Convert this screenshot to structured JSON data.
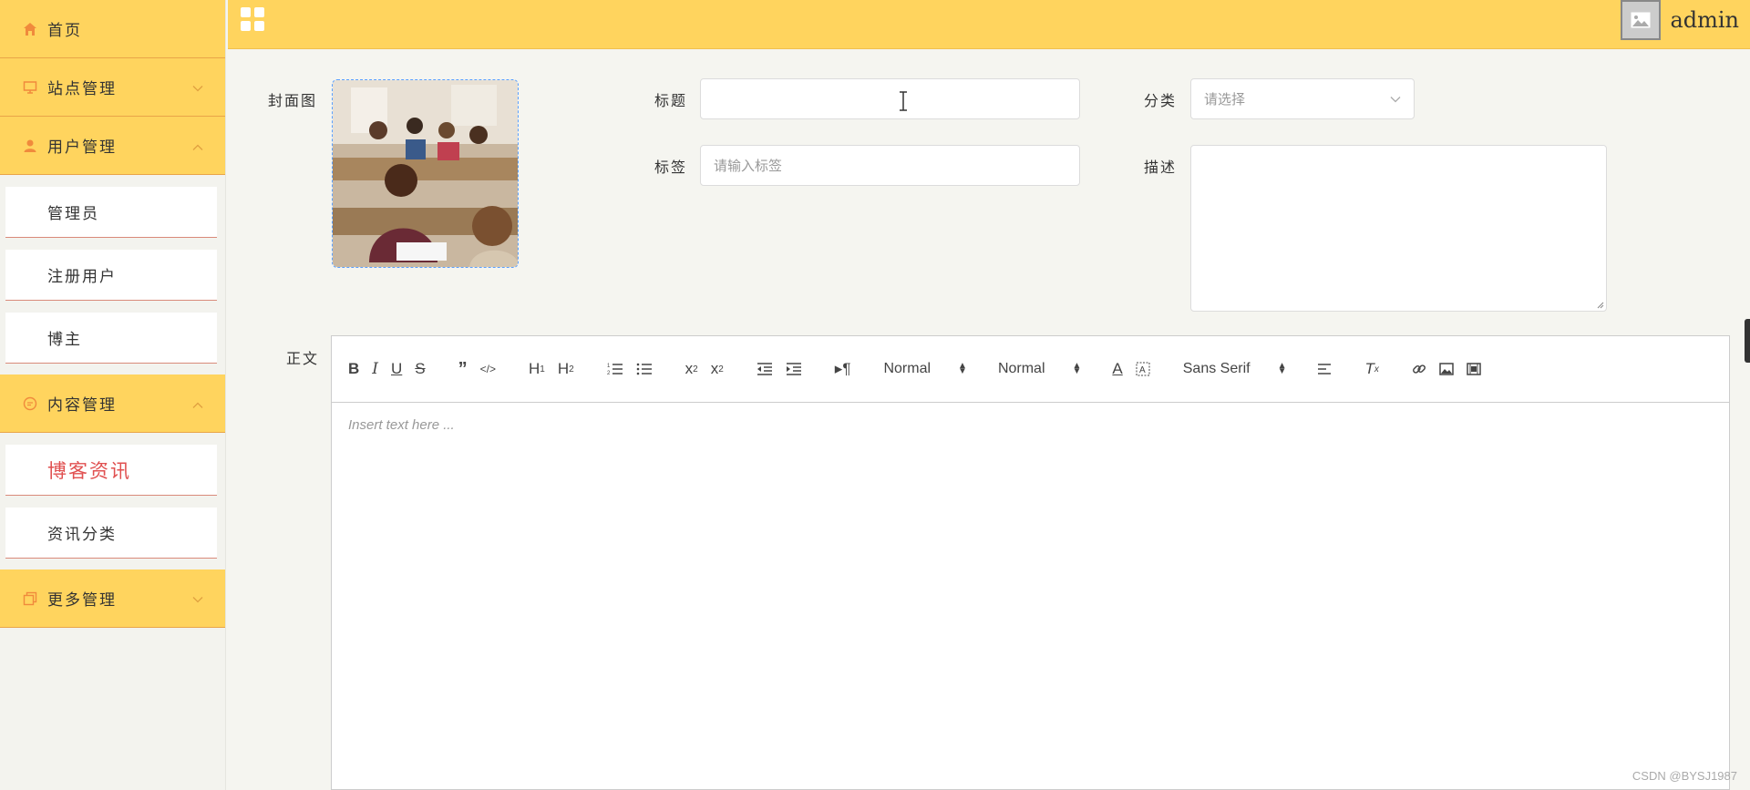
{
  "sidebar": {
    "home": {
      "label": "首页",
      "icon": "home-icon"
    },
    "groups": [
      {
        "label": "站点管理",
        "icon": "monitor-icon",
        "expanded": false
      },
      {
        "label": "用户管理",
        "icon": "user-icon",
        "expanded": true,
        "items": [
          "管理员",
          "注册用户",
          "博主"
        ]
      },
      {
        "label": "内容管理",
        "icon": "chat-icon",
        "expanded": true,
        "items": [
          "博客资讯",
          "资讯分类"
        ]
      },
      {
        "label": "更多管理",
        "icon": "copy-icon",
        "expanded": false
      }
    ],
    "active_item": "博客资讯"
  },
  "topbar": {
    "menu_icon": "grid-icon",
    "username": "admin",
    "avatar_icon": "image-icon"
  },
  "form": {
    "cover_label": "封面图",
    "title_label": "标题",
    "title_value": "",
    "category_label": "分类",
    "category_placeholder": "请选择",
    "tags_label": "标签",
    "tags_placeholder": "请输入标签",
    "desc_label": "描述",
    "desc_value": "",
    "body_label": "正文"
  },
  "editor": {
    "placeholder": "Insert text here ...",
    "header_picker": "Normal",
    "size_picker": "Normal",
    "font_picker": "Sans Serif",
    "buttons": [
      "bold",
      "italic",
      "underline",
      "strike",
      "blockquote",
      "code-block",
      "h1",
      "h2",
      "ordered-list",
      "bullet-list",
      "subscript",
      "superscript",
      "outdent",
      "indent",
      "direction",
      "color",
      "background",
      "align",
      "clean",
      "link",
      "image",
      "video"
    ]
  },
  "colors": {
    "accent": "#ffd45e",
    "active_text": "#e05050",
    "icon_orange": "#f08a3c"
  },
  "watermark": "CSDN @BYSJ1987"
}
